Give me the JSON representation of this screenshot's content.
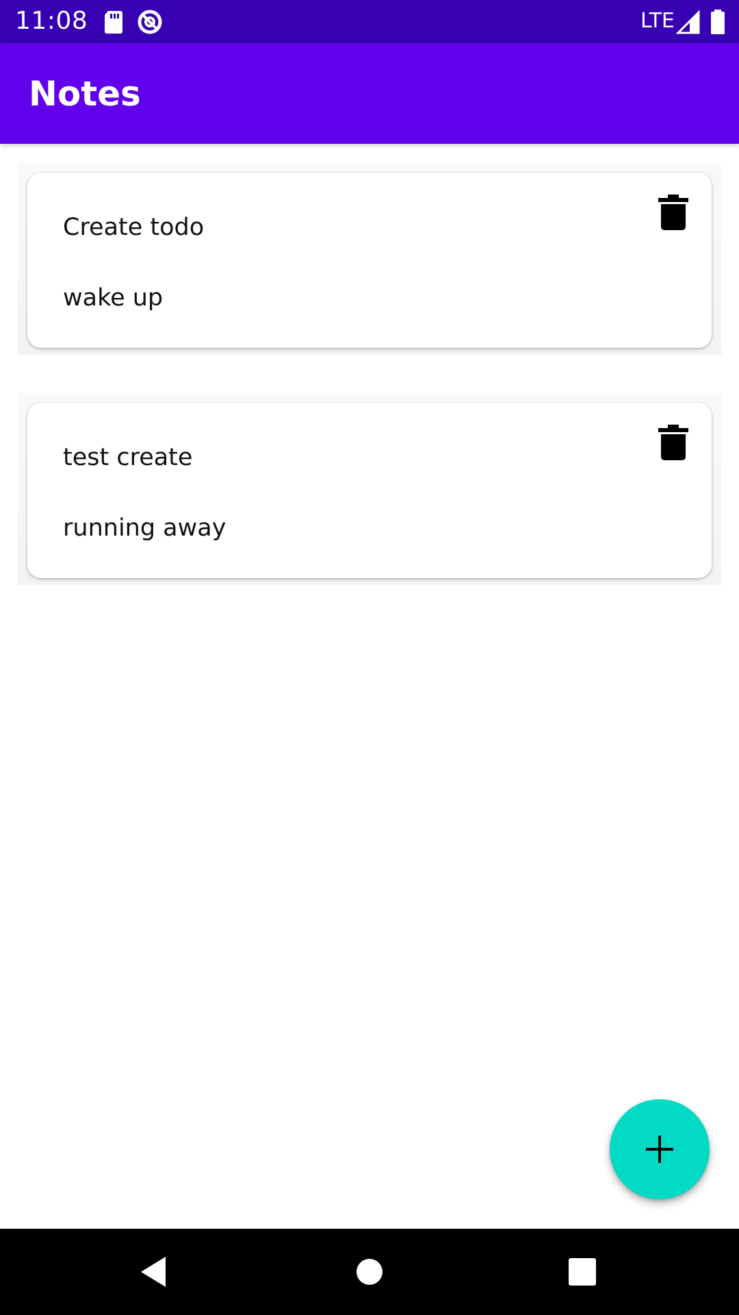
{
  "status_bar": {
    "time": "11:08",
    "network": "LTE",
    "icons": [
      "sd-card-icon",
      "data-saver-icon",
      "signal-icon",
      "battery-icon"
    ]
  },
  "app_bar": {
    "title": "Notes",
    "color": "#6200ee",
    "status_color": "#3700b3"
  },
  "notes": [
    {
      "title": "Create todo",
      "body": "wake up",
      "action_icon": "delete-icon"
    },
    {
      "title": "test create",
      "body": "running away",
      "action_icon": "delete-icon"
    }
  ],
  "fab": {
    "icon": "plus-icon",
    "color": "#03dac5"
  },
  "navigation": {
    "buttons": [
      "back-icon",
      "home-icon",
      "recents-icon"
    ]
  }
}
